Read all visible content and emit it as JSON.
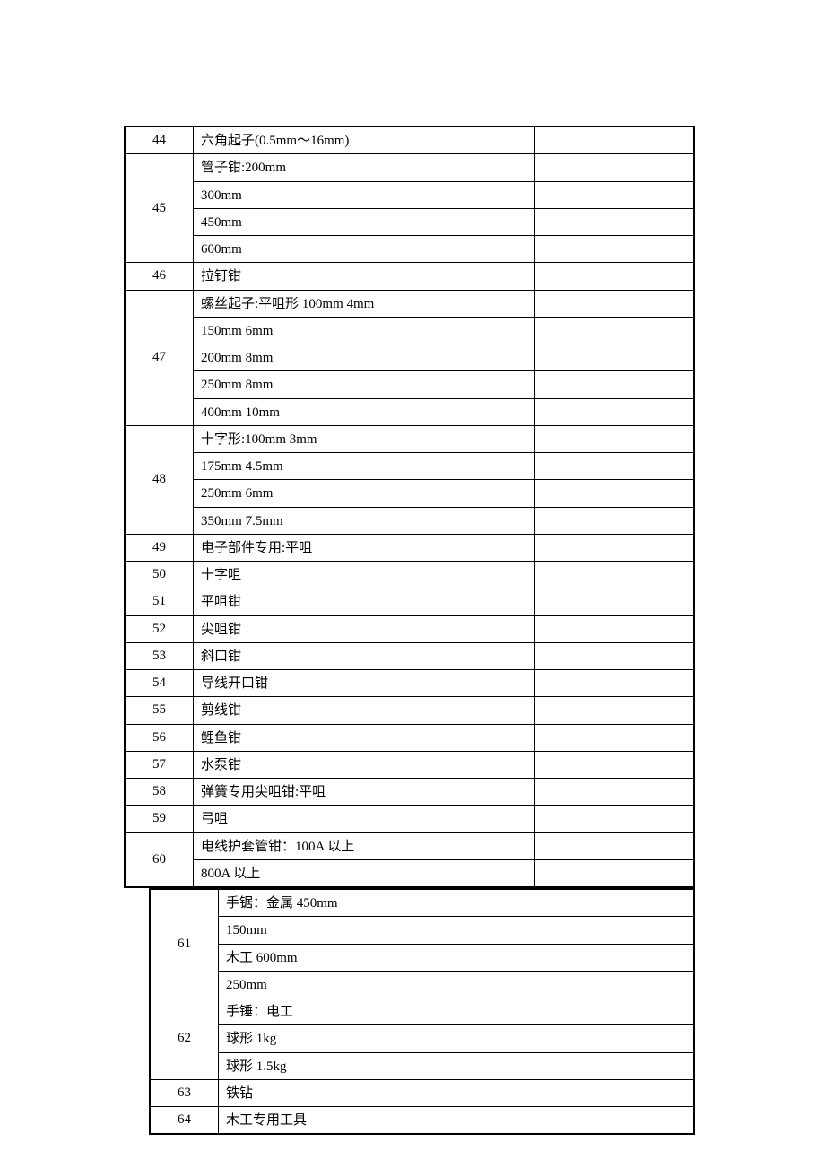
{
  "table1": [
    {
      "num": "44",
      "items": [
        "六角起子(0.5mm～16mm)"
      ]
    },
    {
      "num": "45",
      "items": [
        "管子钳:200mm",
        "300mm",
        "450mm",
        "600mm"
      ]
    },
    {
      "num": "46",
      "items": [
        "拉钉钳"
      ]
    },
    {
      "num": "47",
      "items": [
        "螺丝起子:平咀形 100mm   4mm",
        "150mm   6mm",
        "200mm   8mm",
        "250mm   8mm",
        "400mm   10mm"
      ]
    },
    {
      "num": "48",
      "items": [
        "十字形:100mm   3mm",
        "175mm   4.5mm",
        "250mm   6mm",
        "350mm   7.5mm"
      ]
    },
    {
      "num": "49",
      "items": [
        "电子部件专用:平咀"
      ]
    },
    {
      "num": "50",
      "items": [
        "十字咀"
      ]
    },
    {
      "num": "51",
      "items": [
        "平咀钳"
      ]
    },
    {
      "num": "52",
      "items": [
        "尖咀钳"
      ]
    },
    {
      "num": "53",
      "items": [
        "斜口钳"
      ]
    },
    {
      "num": "54",
      "items": [
        "导线开口钳"
      ]
    },
    {
      "num": "55",
      "items": [
        "剪线钳"
      ]
    },
    {
      "num": "56",
      "items": [
        "鲤鱼钳"
      ]
    },
    {
      "num": "57",
      "items": [
        "水泵钳"
      ]
    },
    {
      "num": "58",
      "items": [
        "弹簧专用尖咀钳:平咀"
      ]
    },
    {
      "num": "59",
      "items": [
        "弓咀"
      ]
    },
    {
      "num": "60",
      "items": [
        "电线护套管钳：100A 以上",
        "800A 以上"
      ]
    }
  ],
  "table2": [
    {
      "num": "61",
      "items": [
        "手锯：金属 450mm",
        "150mm",
        "木工 600mm",
        "250mm"
      ]
    },
    {
      "num": "62",
      "items": [
        "手锤：电工",
        "球形 1kg",
        "球形 1.5kg"
      ]
    },
    {
      "num": "63",
      "items": [
        "铁钻"
      ]
    },
    {
      "num": "64",
      "items": [
        "木工专用工具"
      ]
    }
  ]
}
